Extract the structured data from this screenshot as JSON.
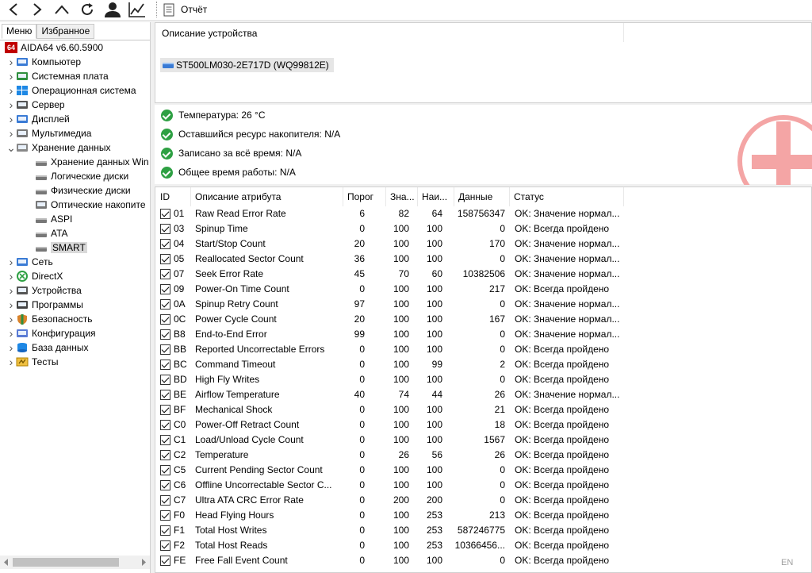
{
  "toolbar": {
    "report_label": "Отчёт"
  },
  "left_tabs": [
    "Меню",
    "Избранное"
  ],
  "tree": [
    {
      "label": "AIDA64 v6.60.5900",
      "icon": "aida64-logo-icon",
      "level": 0,
      "chevron": ""
    },
    {
      "label": "Компьютер",
      "icon": "computer-icon",
      "level": 1,
      "chevron": "›"
    },
    {
      "label": "Системная плата",
      "icon": "motherboard-icon",
      "level": 1,
      "chevron": "›"
    },
    {
      "label": "Операционная система",
      "icon": "windows-icon",
      "level": 1,
      "chevron": "›"
    },
    {
      "label": "Сервер",
      "icon": "server-icon",
      "level": 1,
      "chevron": "›"
    },
    {
      "label": "Дисплей",
      "icon": "display-icon",
      "level": 1,
      "chevron": "›"
    },
    {
      "label": "Мультимедиа",
      "icon": "multimedia-icon",
      "level": 1,
      "chevron": "›"
    },
    {
      "label": "Хранение данных",
      "icon": "storage-icon",
      "level": 1,
      "chevron": "⌄"
    },
    {
      "label": "Хранение данных Win",
      "icon": "drive-icon",
      "level": 2,
      "chevron": ""
    },
    {
      "label": "Логические диски",
      "icon": "logical-disk-icon",
      "level": 2,
      "chevron": ""
    },
    {
      "label": "Физические диски",
      "icon": "drive-icon",
      "level": 2,
      "chevron": ""
    },
    {
      "label": "Оптические накопите",
      "icon": "optical-drive-icon",
      "level": 2,
      "chevron": ""
    },
    {
      "label": "ASPI",
      "icon": "drive-icon",
      "level": 2,
      "chevron": ""
    },
    {
      "label": "ATA",
      "icon": "drive-icon",
      "level": 2,
      "chevron": ""
    },
    {
      "label": "SMART",
      "icon": "drive-icon",
      "level": 2,
      "chevron": "",
      "selected": true
    },
    {
      "label": "Сеть",
      "icon": "network-icon",
      "level": 1,
      "chevron": "›"
    },
    {
      "label": "DirectX",
      "icon": "directx-icon",
      "level": 1,
      "chevron": "›"
    },
    {
      "label": "Устройства",
      "icon": "devices-icon",
      "level": 1,
      "chevron": "›"
    },
    {
      "label": "Программы",
      "icon": "programs-icon",
      "level": 1,
      "chevron": "›"
    },
    {
      "label": "Безопасность",
      "icon": "security-shield-icon",
      "level": 1,
      "chevron": "›"
    },
    {
      "label": "Конфигурация",
      "icon": "config-icon",
      "level": 1,
      "chevron": "›"
    },
    {
      "label": "База данных",
      "icon": "database-icon",
      "level": 1,
      "chevron": "›"
    },
    {
      "label": "Тесты",
      "icon": "tests-icon",
      "level": 1,
      "chevron": "›"
    }
  ],
  "description": {
    "header": "Описание устройства",
    "device": "ST500LM030-2E717D (WQ99812E)"
  },
  "statuses": [
    "Температура: 26 °C",
    "Оставшийся ресурс накопителя: N/A",
    "Записано за всё время: N/A",
    "Общее время работы: N/A"
  ],
  "table": {
    "headers": [
      "ID",
      "Описание атрибута",
      "Порог",
      "Зна...",
      "Наи...",
      "Данные",
      "Статус"
    ],
    "rows": [
      [
        "01",
        "Raw Read Error Rate",
        "6",
        "82",
        "64",
        "158756347",
        "OK: Значение нормал..."
      ],
      [
        "03",
        "Spinup Time",
        "0",
        "100",
        "100",
        "0",
        "OK: Всегда пройдено"
      ],
      [
        "04",
        "Start/Stop Count",
        "20",
        "100",
        "100",
        "170",
        "OK: Значение нормал..."
      ],
      [
        "05",
        "Reallocated Sector Count",
        "36",
        "100",
        "100",
        "0",
        "OK: Значение нормал..."
      ],
      [
        "07",
        "Seek Error Rate",
        "45",
        "70",
        "60",
        "10382506",
        "OK: Значение нормал..."
      ],
      [
        "09",
        "Power-On Time Count",
        "0",
        "100",
        "100",
        "217",
        "OK: Всегда пройдено"
      ],
      [
        "0A",
        "Spinup Retry Count",
        "97",
        "100",
        "100",
        "0",
        "OK: Значение нормал..."
      ],
      [
        "0C",
        "Power Cycle Count",
        "20",
        "100",
        "100",
        "167",
        "OK: Значение нормал..."
      ],
      [
        "B8",
        "End-to-End Error",
        "99",
        "100",
        "100",
        "0",
        "OK: Значение нормал..."
      ],
      [
        "BB",
        "Reported Uncorrectable Errors",
        "0",
        "100",
        "100",
        "0",
        "OK: Всегда пройдено"
      ],
      [
        "BC",
        "Command Timeout",
        "0",
        "100",
        "99",
        "2",
        "OK: Всегда пройдено"
      ],
      [
        "BD",
        "High Fly Writes",
        "0",
        "100",
        "100",
        "0",
        "OK: Всегда пройдено"
      ],
      [
        "BE",
        "Airflow Temperature",
        "40",
        "74",
        "44",
        "26",
        "OK: Значение нормал..."
      ],
      [
        "BF",
        "Mechanical Shock",
        "0",
        "100",
        "100",
        "21",
        "OK: Всегда пройдено"
      ],
      [
        "C0",
        "Power-Off Retract Count",
        "0",
        "100",
        "100",
        "18",
        "OK: Всегда пройдено"
      ],
      [
        "C1",
        "Load/Unload Cycle Count",
        "0",
        "100",
        "100",
        "1567",
        "OK: Всегда пройдено"
      ],
      [
        "C2",
        "Temperature",
        "0",
        "26",
        "56",
        "26",
        "OK: Всегда пройдено"
      ],
      [
        "C5",
        "Current Pending Sector Count",
        "0",
        "100",
        "100",
        "0",
        "OK: Всегда пройдено"
      ],
      [
        "C6",
        "Offline Uncorrectable Sector C...",
        "0",
        "100",
        "100",
        "0",
        "OK: Всегда пройдено"
      ],
      [
        "C7",
        "Ultra ATA CRC Error Rate",
        "0",
        "200",
        "200",
        "0",
        "OK: Всегда пройдено"
      ],
      [
        "F0",
        "Head Flying Hours",
        "0",
        "100",
        "253",
        "213",
        "OK: Всегда пройдено"
      ],
      [
        "F1",
        "Total Host Writes",
        "0",
        "100",
        "253",
        "587246775",
        "OK: Всегда пройдено"
      ],
      [
        "F2",
        "Total Host Reads",
        "0",
        "100",
        "253",
        "10366456...",
        "OK: Всегда пройдено"
      ],
      [
        "FE",
        "Free Fall Event Count",
        "0",
        "100",
        "100",
        "0",
        "OK: Всегда пройдено"
      ]
    ]
  },
  "language_indicator": "EN",
  "colors": {
    "ok_green": "#2ea043",
    "selection": "#d9d9d9",
    "red_cross": "#f4a5a5"
  }
}
